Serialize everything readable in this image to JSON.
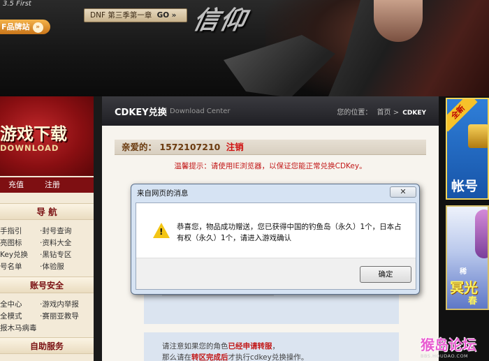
{
  "banner": {
    "logo": "3.5 First",
    "season_label": "DNF 第三季第一章",
    "season_go": "GO",
    "season_arrows": "»",
    "brand_label": "F品牌站",
    "title_art": "信仰"
  },
  "left": {
    "download_title": "游戏下载",
    "download_sub": "DOWNLOAD",
    "recharge": "充值",
    "register": "注册",
    "nav_title": "导 航",
    "nav_items": [
      "手指引",
      "·封号查询",
      "亮图标",
      "·资料大全",
      "Key兑换",
      "·黑钻专区",
      "号名单",
      "·体验服"
    ],
    "security_title": "账号安全",
    "security_items": [
      "全中心",
      "·游戏内举报",
      "全模式",
      "·赛丽亚教导",
      "报木马病毒"
    ],
    "service_title": "自助服务"
  },
  "center": {
    "header_title": "CDKEY兑换",
    "header_sep": "|",
    "header_sub": "Download Center",
    "crumb_label": "您的位置：",
    "crumb_home": "首页",
    "crumb_arrow": ">",
    "crumb_current": "CDKEY",
    "greeting": "亲爱的：",
    "user_id": "1572107210",
    "logout": "注销",
    "tip": "温馨提示：请使用IE浏览器，以保证您能正常兑换CDKey。",
    "notice_line1_a": "请注意如果您的角色",
    "notice_line1_b": "已经申请转服",
    "notice_line1_c": "，",
    "notice_line2_a": "那么请在",
    "notice_line2_b": "转区完成后",
    "notice_line2_c": "才执行cdkey兑换操作。"
  },
  "right": {
    "promo1_ribbon": "全新",
    "promo1_text": "帐号",
    "promo2_t1": "稀",
    "promo2_t2": "冥光",
    "promo2_t3": "春"
  },
  "watermark": {
    "logo": "猴岛论坛",
    "url": "BBS.HOUDAO.COM"
  },
  "dialog": {
    "title": "来自网页的消息",
    "close": "✕",
    "warning_mark": "!",
    "message": "恭喜您，物品成功赠送，您已获得中国的钓鱼岛（永久）1个，日本占有权（永久）1个，请进入游戏确认",
    "ok_label": "确定"
  }
}
